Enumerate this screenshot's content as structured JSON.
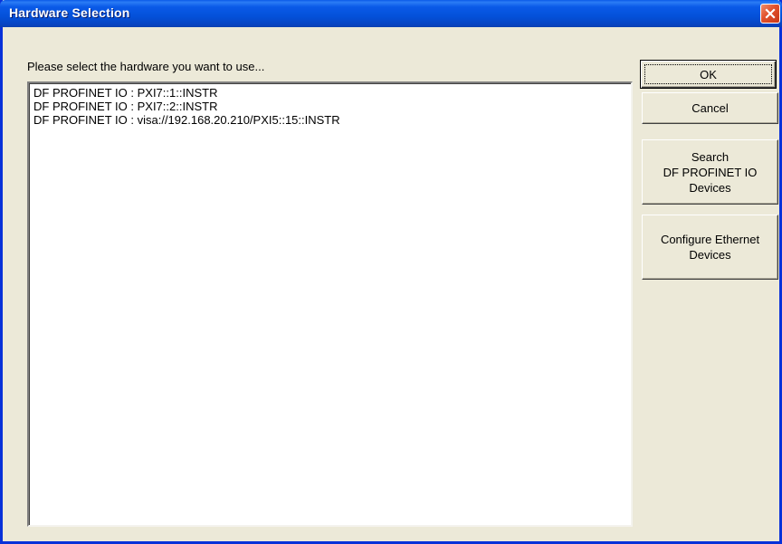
{
  "window": {
    "title": "Hardware Selection"
  },
  "prompt": "Please select the hardware you want to use...",
  "hardware_list": {
    "items": [
      "DF PROFINET IO : PXI7::1::INSTR",
      "DF PROFINET IO : PXI7::2::INSTR",
      "DF PROFINET IO : visa://192.168.20.210/PXI5::15::INSTR"
    ]
  },
  "buttons": {
    "ok": "OK",
    "cancel": "Cancel",
    "search": "Search\nDF PROFINET IO\nDevices",
    "configure": "Configure Ethernet\nDevices"
  },
  "icons": {
    "close": "close-icon"
  },
  "colors": {
    "titlebar": "#0a5ae8",
    "window_bg": "#ece9d8",
    "close_button": "#e0502a"
  }
}
